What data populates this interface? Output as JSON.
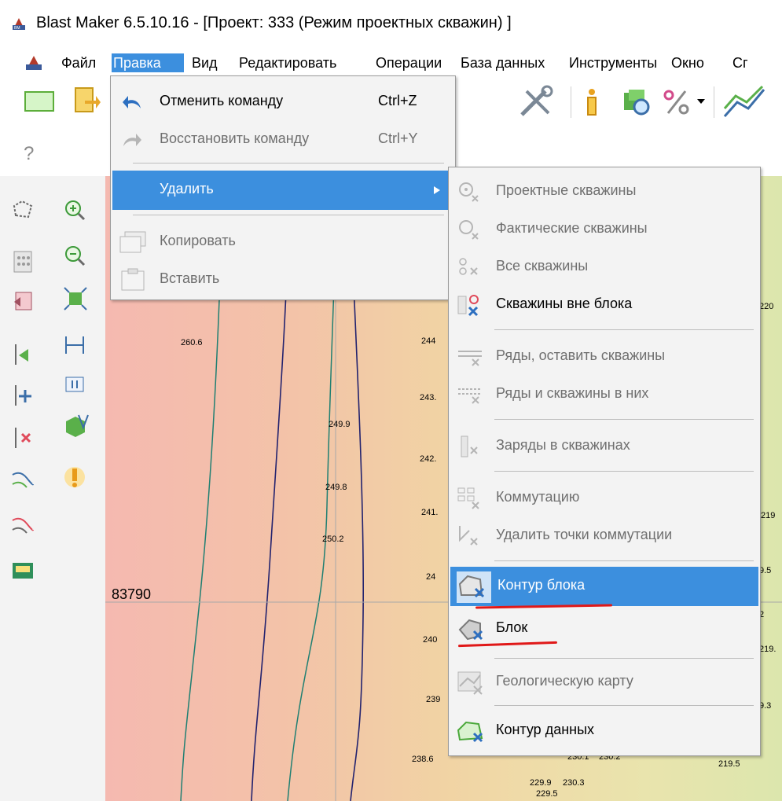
{
  "window": {
    "title": "Blast Maker 6.5.10.16 - [Проект: 333 (Режим проектных скважин)   ]"
  },
  "menubar": {
    "items": [
      "Файл",
      "Правка",
      "Вид",
      "Редактировать",
      "Операции",
      "База данных",
      "Инструменты",
      "Окно",
      "Сг"
    ],
    "active": "Правка"
  },
  "edit_menu": {
    "items": [
      {
        "label": "Отменить команду",
        "shortcut": "Ctrl+Z",
        "enabled": true
      },
      {
        "label": "Восстановить команду",
        "shortcut": "Ctrl+Y",
        "enabled": false
      },
      {
        "label": "Удалить",
        "submenu": true,
        "highlighted": true
      },
      {
        "label": "Копировать",
        "enabled": false
      },
      {
        "label": "Вставить",
        "enabled": false
      }
    ]
  },
  "delete_submenu": {
    "items": [
      {
        "label": "Проектные скважины",
        "enabled": false
      },
      {
        "label": "Фактические скважины",
        "enabled": false
      },
      {
        "label": "Все скважины",
        "enabled": false
      },
      {
        "label": "Скважины вне блока",
        "enabled": true
      },
      {
        "label": "Ряды, оставить скважины",
        "enabled": false
      },
      {
        "label": "Ряды и скважины в них",
        "enabled": false
      },
      {
        "label": "Заряды в скважинах",
        "enabled": false
      },
      {
        "label": "Коммутацию",
        "enabled": false
      },
      {
        "label": "Удалить точки коммутации",
        "enabled": false
      },
      {
        "label": "Контур блока",
        "enabled": true,
        "highlighted": true
      },
      {
        "label": "Блок",
        "enabled": true
      },
      {
        "label": "Геологическую карту",
        "enabled": false
      },
      {
        "label": "Контур данных",
        "enabled": true
      }
    ]
  },
  "map": {
    "coord_label": "83790",
    "point_labels": [
      "260.6",
      "244",
      "243.",
      "249.9",
      "242.",
      "249.8",
      "241.",
      "250.2",
      "24",
      "240",
      "239",
      "238.6",
      "220",
      "219",
      "9.5",
      "2",
      "219.",
      "9.3",
      "219.5",
      "229.9",
      "230.3",
      "229.5",
      "230.1",
      "230.2"
    ]
  },
  "colors": {
    "highlight": "#3c8fde",
    "menu_bg": "#f3f3f3",
    "annotation": "#e01818"
  }
}
